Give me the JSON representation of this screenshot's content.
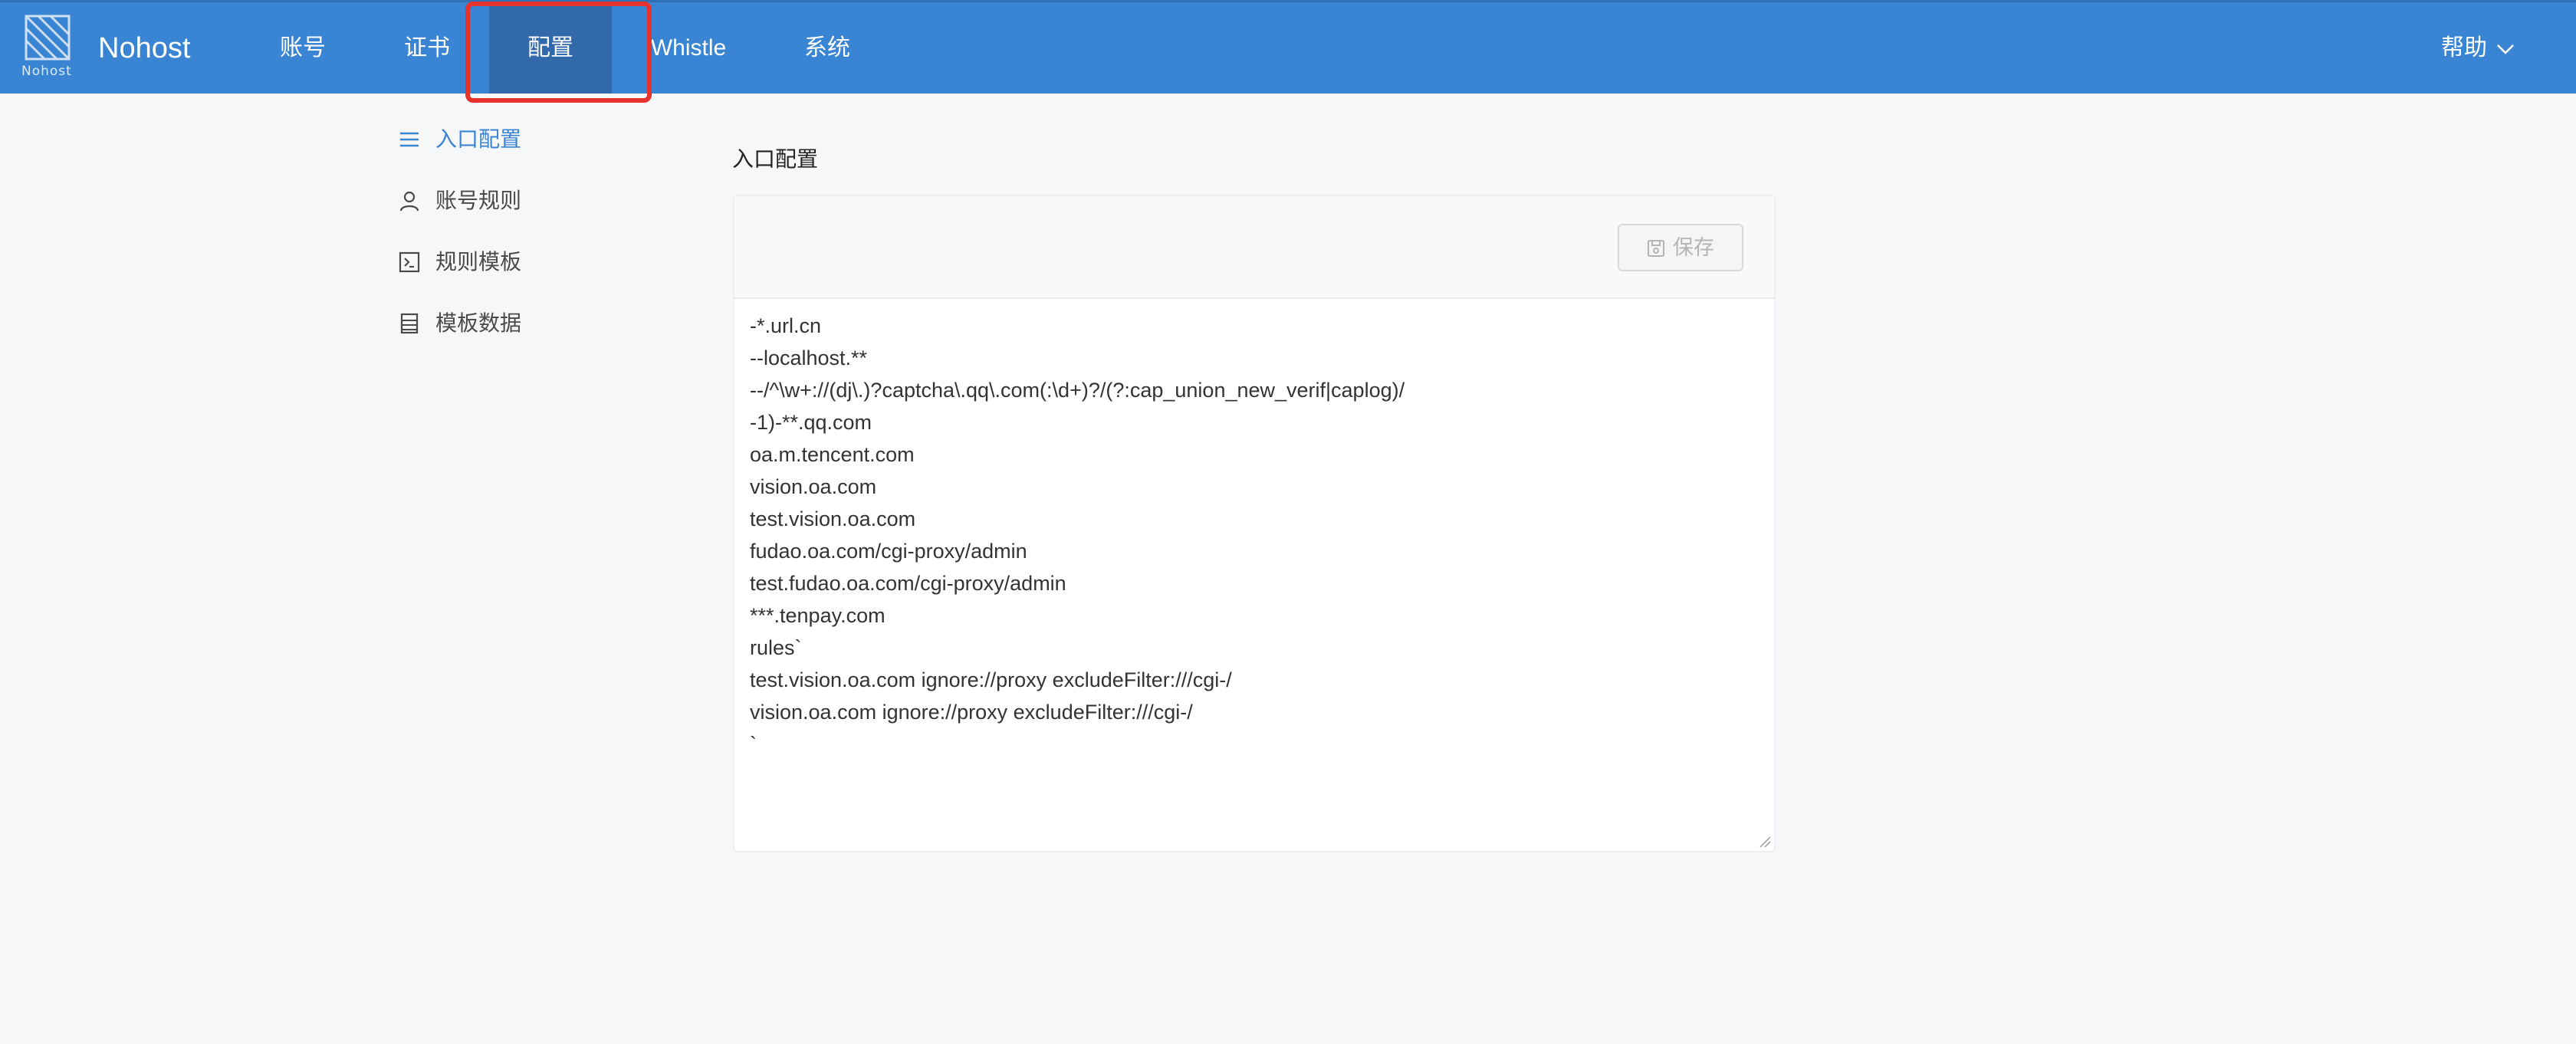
{
  "header": {
    "logo_text": "Nohost",
    "brand": "Nohost",
    "nav": [
      {
        "label": "账号"
      },
      {
        "label": "证书"
      },
      {
        "label": "配置"
      },
      {
        "label": "Whistle"
      },
      {
        "label": "系统"
      }
    ],
    "help_label": "帮助"
  },
  "sidebar": {
    "items": [
      {
        "label": "入口配置",
        "icon": "list-icon"
      },
      {
        "label": "账号规则",
        "icon": "user-icon"
      },
      {
        "label": "规则模板",
        "icon": "terminal-icon"
      },
      {
        "label": "模板数据",
        "icon": "document-icon"
      }
    ]
  },
  "main": {
    "title": "入口配置",
    "save_label": "保存",
    "editor_text": "-*.url.cn\n--localhost.**\n--/^\\w+://(dj\\.)?captcha\\.qq\\.com(:\\d+)?/(?:cap_union_new_verif|caplog)/\n-1)-**.qq.com\noa.m.tencent.com\nvision.oa.com\ntest.vision.oa.com\nfudao.oa.com/cgi-proxy/admin\ntest.fudao.oa.com/cgi-proxy/admin\n***.tenpay.com\nrules`\ntest.vision.oa.com ignore://proxy excludeFilter:///cgi-/\nvision.oa.com ignore://proxy excludeFilter:///cgi-/\n`"
  },
  "colors": {
    "header_bg": "#3a85d3",
    "nav_active_bg": "#3169aa",
    "highlight_border": "#e5322d",
    "sidebar_active": "#3a85d3",
    "page_bg": "#f6f7f9"
  }
}
